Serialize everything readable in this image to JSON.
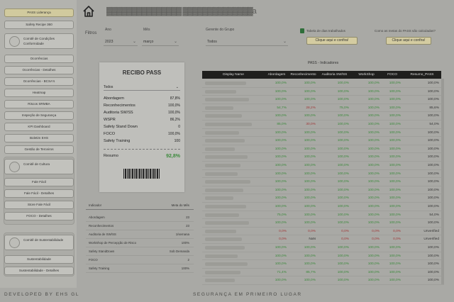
{
  "sidebar": {
    "items": [
      {
        "label": "PASS Liderança",
        "active": true
      },
      {
        "label": "Safety Recipe 360"
      },
      {
        "label": "Comitê de Condições Conformidade"
      },
      {
        "label": "Ocorrências"
      },
      {
        "label": "Ocorrências - Detalhes"
      },
      {
        "label": "Ocorrências - BCSA's"
      },
      {
        "label": "Heatmap"
      },
      {
        "label": "Riscos SRMBA"
      },
      {
        "label": "Inspeção de Segurança"
      },
      {
        "label": "KPI Dashboard"
      },
      {
        "label": "Boletim EHS"
      },
      {
        "label": "Gestão de Terceiros"
      }
    ],
    "group1": {
      "label": "Comitê de Cultura",
      "items": [
        "Fale Fácil",
        "Fale Fácil - Detalhes",
        "Store Fale Fácil",
        "FOCO - Detalhes"
      ]
    },
    "group2": {
      "label": "Comitê de Sustentabilidade",
      "items": [
        "Sustentabilidade",
        "Sustentabilidade - Detalhes"
      ]
    }
  },
  "header": {
    "title_masked": "▓▓▓▓▓▓▓▓▓▓▓▓▓▓▓  ▓▓▓▓▓▓▓▓▓▓▓▓▓▓a"
  },
  "filters": {
    "label": "Filtros",
    "ano": {
      "label": "Ano",
      "value": "2023"
    },
    "mes": {
      "label": "Mês",
      "value": "março"
    },
    "gerente": {
      "label": "Gerente do Grupo",
      "value": "Todos"
    },
    "tabela_label": "Tabela de dias trabalhados",
    "tabela_button": "Clique aqui e confira!",
    "como_label": "Como as metas do PASS são calculadas?",
    "como_button": "Clique aqui e confira!"
  },
  "receipt": {
    "title": "RECIBO PASS",
    "dropdown": "Todos",
    "rows": [
      {
        "label": "Abordagem",
        "value": "87,8%"
      },
      {
        "label": "Reconhecimentos",
        "value": "100,0%"
      },
      {
        "label": "Auditoria SW/SS",
        "value": "100,0%"
      },
      {
        "label": "WSPR",
        "value": "86,2%"
      },
      {
        "label": "Safety Stand Down",
        "value": "0"
      },
      {
        "label": "FOCO",
        "value": "100,0%"
      },
      {
        "label": "Safety Training",
        "value": "100"
      }
    ],
    "total_label": "Resumo",
    "total_value": "92,8%"
  },
  "metas": {
    "header": [
      "Indicador",
      "Meta do Mês"
    ],
    "rows": [
      [
        "Abordagem",
        "23"
      ],
      [
        "Reconhecimentos",
        "23"
      ],
      [
        "Auditoria de SW/SS",
        "1/semana"
      ],
      [
        "WorkShop de Percepção de Risco",
        "100%"
      ],
      [
        "Safety StandDown",
        "Sob Demanda"
      ],
      [
        "FOCO",
        "2"
      ],
      [
        "Safety Training",
        "100%"
      ]
    ]
  },
  "pass_table": {
    "title": "PASS - Indicadores",
    "columns": [
      "Display Name",
      "Abordagem",
      "Reconhecimento",
      "Auditoria SW/SS",
      "WorkShop",
      "FOCO",
      "Resumo_PASS"
    ],
    "rows": [
      [
        "100,0%",
        "100,0%",
        "100,0%",
        "100,0%",
        "100,0%",
        "100,0%"
      ],
      [
        "100,0%",
        "100,0%",
        "100,0%",
        "100,0%",
        "100,0%",
        "100,0%"
      ],
      [
        "100,0%",
        "100,0%",
        "100,0%",
        "100,0%",
        "100,0%",
        "100,0%"
      ],
      [
        "54,7%",
        "28,2%",
        "75,0%",
        "100,0%",
        "100,0%",
        "85,6%"
      ],
      [
        "100,0%",
        "100,0%",
        "100,0%",
        "100,0%",
        "100,0%",
        "100,0%"
      ],
      [
        "85,0%",
        "30,0%",
        "100,0%",
        "100,0%",
        "100,0%",
        "54,0%"
      ],
      [
        "100,0%",
        "100,0%",
        "100,0%",
        "100,0%",
        "100,0%",
        "100,0%"
      ],
      [
        "100,0%",
        "100,0%",
        "100,0%",
        "100,0%",
        "100,0%",
        "100,0%"
      ],
      [
        "100,0%",
        "100,0%",
        "100,0%",
        "100,0%",
        "100,0%",
        "100,0%"
      ],
      [
        "100,0%",
        "100,0%",
        "100,0%",
        "100,0%",
        "100,0%",
        "100,0%"
      ],
      [
        "100,0%",
        "100,0%",
        "100,0%",
        "100,0%",
        "100,0%",
        "100,0%"
      ],
      [
        "100,0%",
        "100,0%",
        "100,0%",
        "100,0%",
        "100,0%",
        "100,0%"
      ],
      [
        "100,0%",
        "100,0%",
        "100,0%",
        "100,0%",
        "100,0%",
        "100,0%"
      ],
      [
        "100,0%",
        "100,0%",
        "100,0%",
        "100,0%",
        "100,0%",
        "100,0%"
      ],
      [
        "100,0%",
        "100,0%",
        "100,0%",
        "100,0%",
        "100,0%",
        "100,0%"
      ],
      [
        "100,0%",
        "100,0%",
        "100,0%",
        "100,0%",
        "100,0%",
        "100,0%"
      ],
      [
        "75,0%",
        "100,0%",
        "100,0%",
        "100,0%",
        "100,0%",
        "54,0%"
      ],
      [
        "100,0%",
        "100,0%",
        "100,0%",
        "100,0%",
        "100,0%",
        "100,0%"
      ],
      [
        "0,0%",
        "0,0%",
        "0,0%",
        "0,0%",
        "0,0%",
        "Unverified"
      ],
      [
        "0,0%",
        "NaN",
        "0,0%",
        "0,0%",
        "0,0%",
        "Unverified"
      ],
      [
        "100,0%",
        "100,0%",
        "100,0%",
        "100,0%",
        "100,0%",
        "100,0%"
      ],
      [
        "100,0%",
        "100,0%",
        "100,0%",
        "100,0%",
        "100,0%",
        "100,0%"
      ],
      [
        "100,0%",
        "100,0%",
        "100,0%",
        "100,0%",
        "100,0%",
        "100,0%"
      ],
      [
        "71,4%",
        "85,7%",
        "100,0%",
        "100,0%",
        "100,0%",
        "100,0%"
      ],
      [
        "100,0%",
        "100,0%",
        "100,0%",
        "100,0%",
        "100,0%",
        "100,0%"
      ]
    ]
  },
  "footer": {
    "left": "DEVELOPED BY EHS GL",
    "center": "SEGURANÇA EM PRIMEIRO LUGAR"
  },
  "colors": {
    "green": "#3c8a3c",
    "red": "#a03a3a",
    "yellow": "#d4cca1"
  }
}
